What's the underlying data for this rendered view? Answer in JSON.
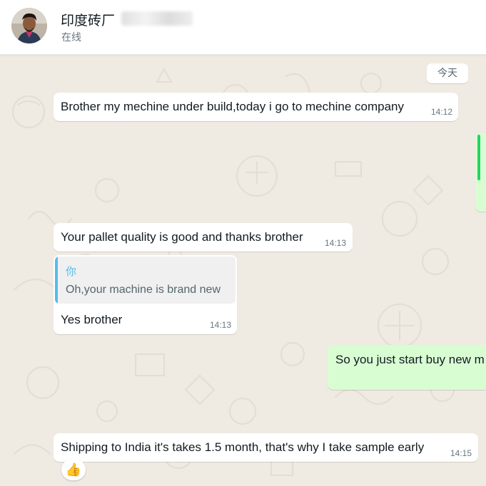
{
  "header": {
    "contact_name": "印度砖厂",
    "status": "在线"
  },
  "chat": {
    "date_label": "今天",
    "messages": [
      {
        "text": "Brother my mechine under build,today i go to mechine company",
        "time": "14:12"
      },
      {
        "text": "Your pallet quality is good and thanks brother",
        "time": "14:13"
      },
      {
        "quote_author": "你",
        "quote_text": "Oh,your machine is brand new",
        "text": "Yes brother",
        "time": "14:13"
      },
      {
        "text": "So you just start buy new m"
      },
      {
        "text": "Shipping to India it's  takes 1.5 month, that's why I take sample early",
        "time": "14:15",
        "reaction": "👍"
      }
    ]
  },
  "colors": {
    "incoming_bubble": "#ffffff",
    "outgoing_bubble": "#d9fdd3",
    "wallpaper": "#efeae2",
    "quote_accent": "#53bdeb"
  },
  "icons": {
    "avatar": "contact-avatar-photo",
    "reaction": "thumbs-up-emoji"
  }
}
